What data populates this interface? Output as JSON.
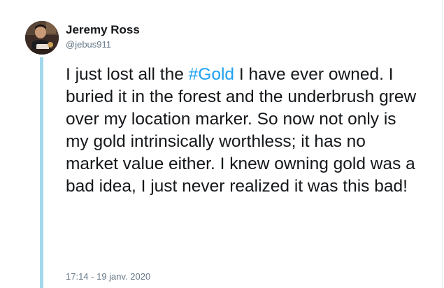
{
  "author": {
    "display_name": "Jeremy Ross",
    "handle": "@jebus911"
  },
  "tweet": {
    "text_before": "I just lost all the ",
    "hashtag": "#Gold",
    "text_after": " I have ever owned. I buried it in the forest and the underbrush grew over my location marker. So now not only is my gold intrinsically worthless; it has no market value either. I knew owning gold was a bad idea, I just never realized it was this bad!",
    "timestamp": "17:14 - 19 janv. 2020"
  },
  "colors": {
    "hashtag": "#1da1f2",
    "thread_line": "#a3d8ec",
    "secondary_text": "#657786",
    "primary_text": "#14171a"
  },
  "icons": {
    "avatar": "user-profile-photo"
  }
}
